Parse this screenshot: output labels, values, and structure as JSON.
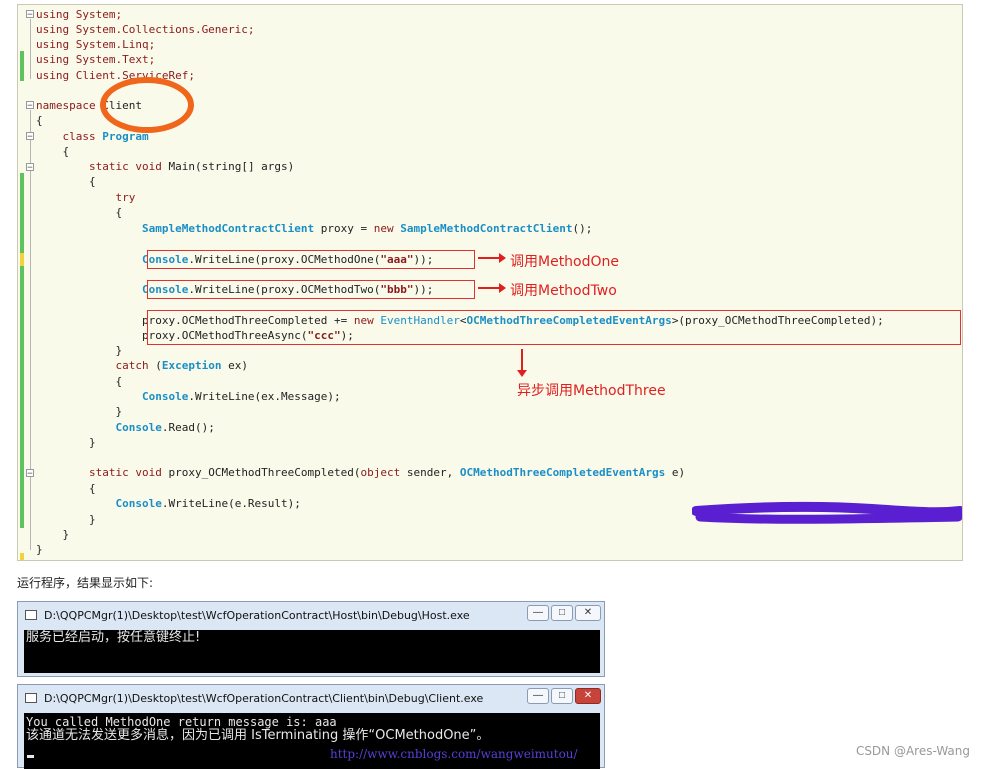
{
  "code": {
    "usings": [
      "using System;",
      "using System.Collections.Generic;",
      "using System.Linq;",
      "using System.Text;",
      "using Client.ServiceRef;"
    ],
    "ns_kw": "namespace",
    "ns_name": "Client",
    "brace_open": "{",
    "brace_close": "}",
    "class_kw": "class",
    "class_name": "Program",
    "main_sig_kw": "static void",
    "main_sig": "Main(string[] args)",
    "try_kw": "try",
    "proxy_type": "SampleMethodContractClient",
    "proxy_mid": " proxy = ",
    "new_kw": "new",
    "proxy_ctor": "SampleMethodContractClient",
    "proxy_end": "();",
    "console": "Console",
    "line1_mid": ".WriteLine(proxy.OCMethodOne(",
    "line1_str": "\"aaa\"",
    "line1_end": "));",
    "line2_mid": ".WriteLine(proxy.OCMethodTwo(",
    "line2_str": "\"bbb\"",
    "line2_end": "));",
    "line3_a": "proxy.OCMethodThreeCompleted += ",
    "line3_handler": "EventHandler",
    "line3_lt": "<",
    "line3_args": "OCMethodThreeCompletedEventArgs",
    "line3_end": ">(proxy_OCMethodThreeCompleted);",
    "line4_a": "proxy.OCMethodThreeAsync(",
    "line4_str": "\"ccc\"",
    "line4_end": ");",
    "catch_kw": "catch",
    "catch_open": " (",
    "exception_type": "Exception",
    "catch_var": " ex)",
    "ex_line": ".WriteLine(ex.Message);",
    "read_line": ".Read();",
    "handler_kw": "static void",
    "handler_name": " proxy_OCMethodThreeCompleted(",
    "object_kw": "object",
    "handler_mid": " sender, ",
    "handler_type": "OCMethodThreeCompletedEventArgs",
    "handler_end": " e)",
    "result_line": ".WriteLine(e.Result);"
  },
  "annotations": {
    "call_one": "调用MethodOne",
    "call_two": "调用MethodTwo",
    "async_three": "异步调用MethodThree",
    "accent": "#e02020"
  },
  "caption": "运行程序，结果显示如下:",
  "host_window": {
    "title": "D:\\QQPCMgr(1)\\Desktop\\test\\WcfOperationContract\\Host\\bin\\Debug\\Host.exe",
    "output": "服务已经启动，按任意键终止!"
  },
  "client_window": {
    "title": "D:\\QQPCMgr(1)\\Desktop\\test\\WcfOperationContract\\Client\\bin\\Debug\\Client.exe",
    "output_line1": "You called MethodOne return message is: aaa",
    "output_line2": "该通道无法发送更多消息，因为已调用 IsTerminating 操作“OCMethodOne”。",
    "url": "http://www.cnblogs.com/wangweimutou/"
  },
  "window_buttons": {
    "minimize": "—",
    "maximize": "□",
    "close": "✕"
  },
  "watermark": "CSDN @Ares-Wang"
}
